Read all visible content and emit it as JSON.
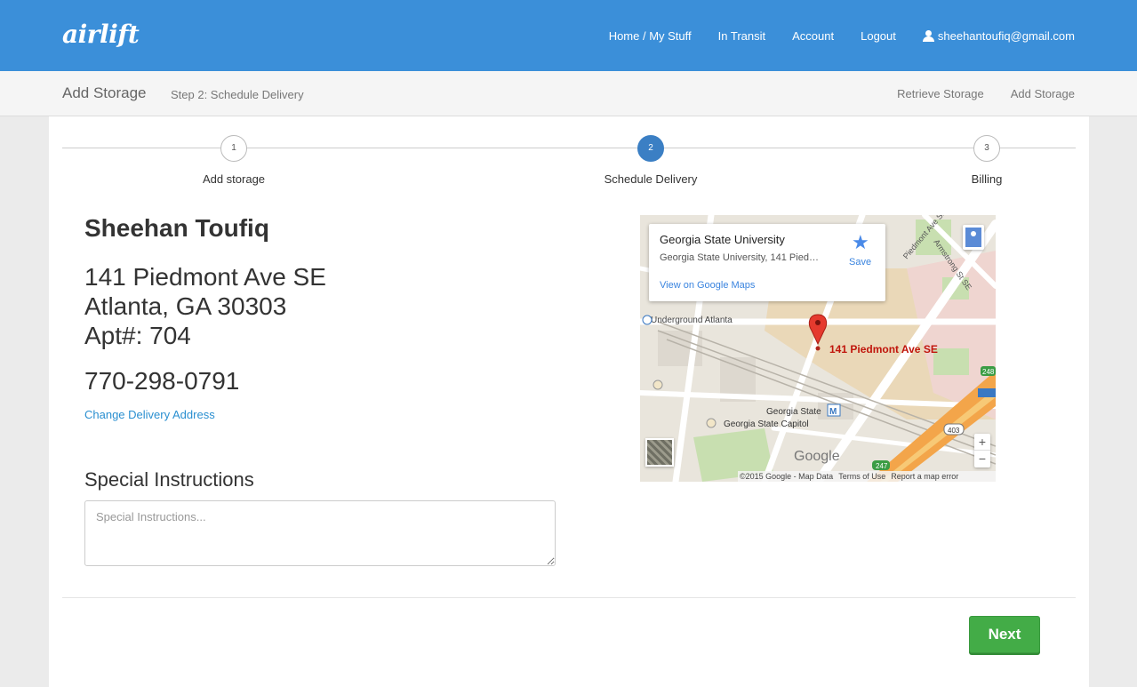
{
  "header": {
    "logo": "airlift",
    "nav": [
      "Home / My Stuff",
      "In Transit",
      "Account",
      "Logout"
    ],
    "user_email": "sheehantoufiq@gmail.com"
  },
  "subheader": {
    "title": "Add Storage",
    "step": "Step 2: Schedule Delivery",
    "links": [
      "Retrieve Storage",
      "Add Storage"
    ]
  },
  "stepper": {
    "active": 2,
    "steps": [
      {
        "number": "1",
        "label": "Add storage"
      },
      {
        "number": "2",
        "label": "Schedule Delivery"
      },
      {
        "number": "3",
        "label": "Billing"
      }
    ]
  },
  "delivery": {
    "name": "Sheehan Toufiq",
    "address_line1": "141 Piedmont Ave SE",
    "address_line2": "Atlanta, GA 30303",
    "apt": "Apt#: 704",
    "phone": "770-298-0791",
    "change_link": "Change Delivery Address"
  },
  "instructions": {
    "heading": "Special Instructions",
    "placeholder": "Special Instructions...",
    "value": ""
  },
  "map": {
    "place_title": "Georgia State University",
    "place_address": "Georgia State University, 141 Pied…",
    "view_link": "View on Google Maps",
    "save_label": "Save",
    "marker_label": "141 Piedmont Ave SE",
    "labels": [
      "Underground Atlanta",
      "Georgia State",
      "Georgia State Capitol",
      "Armstrong St SE",
      "Piedmont Ave SE"
    ],
    "road_shields": [
      "403",
      "247",
      "248"
    ],
    "logo": "Google",
    "footer": [
      "©2015 Google - Map Data",
      "Terms of Use",
      "Report a map error"
    ],
    "zoom_in": "+",
    "zoom_out": "−"
  },
  "actions": {
    "next_label": "Next"
  }
}
